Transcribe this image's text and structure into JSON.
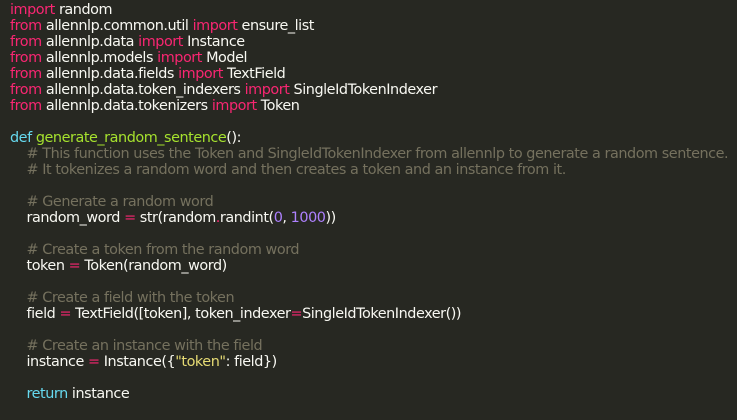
{
  "colors": {
    "background": "#272822",
    "text": "#f8f8f2",
    "keyword": "#f92672",
    "declaration": "#66d9ef",
    "function_name": "#a6e22e",
    "comment": "#75715e",
    "number": "#ae81ff",
    "string": "#e6db74"
  },
  "lines": [
    [
      {
        "t": "import",
        "c": "kw"
      },
      {
        "t": " random"
      }
    ],
    [
      {
        "t": "from",
        "c": "kw"
      },
      {
        "t": " allennlp.common.util "
      },
      {
        "t": "import",
        "c": "kw"
      },
      {
        "t": " ensure_list"
      }
    ],
    [
      {
        "t": "from",
        "c": "kw"
      },
      {
        "t": " allennlp.data "
      },
      {
        "t": "import",
        "c": "kw"
      },
      {
        "t": " Instance"
      }
    ],
    [
      {
        "t": "from",
        "c": "kw"
      },
      {
        "t": " allennlp.models "
      },
      {
        "t": "import",
        "c": "kw"
      },
      {
        "t": " Model"
      }
    ],
    [
      {
        "t": "from",
        "c": "kw"
      },
      {
        "t": " allennlp.data.fields "
      },
      {
        "t": "import",
        "c": "kw"
      },
      {
        "t": " TextField"
      }
    ],
    [
      {
        "t": "from",
        "c": "kw"
      },
      {
        "t": " allennlp.data.token_indexers "
      },
      {
        "t": "import",
        "c": "kw"
      },
      {
        "t": " SingleIdTokenIndexer"
      }
    ],
    [
      {
        "t": "from",
        "c": "kw"
      },
      {
        "t": " allennlp.data.tokenizers "
      },
      {
        "t": "import",
        "c": "kw"
      },
      {
        "t": " Token"
      }
    ],
    [],
    [
      {
        "t": "def",
        "c": "kd"
      },
      {
        "t": " "
      },
      {
        "t": "generate_random_sentence",
        "c": "fn"
      },
      {
        "t": "():"
      }
    ],
    [
      {
        "t": "    "
      },
      {
        "t": "# This function uses the Token and SingleIdTokenIndexer from allennlp to generate a random sentence.",
        "c": "cm"
      }
    ],
    [
      {
        "t": "    "
      },
      {
        "t": "# It tokenizes a random word and then creates a token and an instance from it.",
        "c": "cm"
      }
    ],
    [],
    [
      {
        "t": "    "
      },
      {
        "t": "# Generate a random word",
        "c": "cm"
      }
    ],
    [
      {
        "t": "    random_word "
      },
      {
        "t": "=",
        "c": "op"
      },
      {
        "t": " str(random"
      },
      {
        "t": ".",
        "c": "op"
      },
      {
        "t": "randint("
      },
      {
        "t": "0",
        "c": "num"
      },
      {
        "t": ", "
      },
      {
        "t": "1000",
        "c": "num"
      },
      {
        "t": "))"
      }
    ],
    [],
    [
      {
        "t": "    "
      },
      {
        "t": "# Create a token from the random word",
        "c": "cm"
      }
    ],
    [
      {
        "t": "    token "
      },
      {
        "t": "=",
        "c": "op"
      },
      {
        "t": " Token(random_word)"
      }
    ],
    [],
    [
      {
        "t": "    "
      },
      {
        "t": "# Create a field with the token",
        "c": "cm"
      }
    ],
    [
      {
        "t": "    field "
      },
      {
        "t": "=",
        "c": "op"
      },
      {
        "t": " TextField([token], token_indexer"
      },
      {
        "t": "=",
        "c": "op"
      },
      {
        "t": "SingleIdTokenIndexer())"
      }
    ],
    [],
    [
      {
        "t": "    "
      },
      {
        "t": "# Create an instance with the field",
        "c": "cm"
      }
    ],
    [
      {
        "t": "    instance "
      },
      {
        "t": "=",
        "c": "op"
      },
      {
        "t": " Instance({"
      },
      {
        "t": "\"token\"",
        "c": "str"
      },
      {
        "t": ": field})"
      }
    ],
    [],
    [
      {
        "t": "    "
      },
      {
        "t": "return",
        "c": "kd"
      },
      {
        "t": " instance"
      }
    ]
  ]
}
